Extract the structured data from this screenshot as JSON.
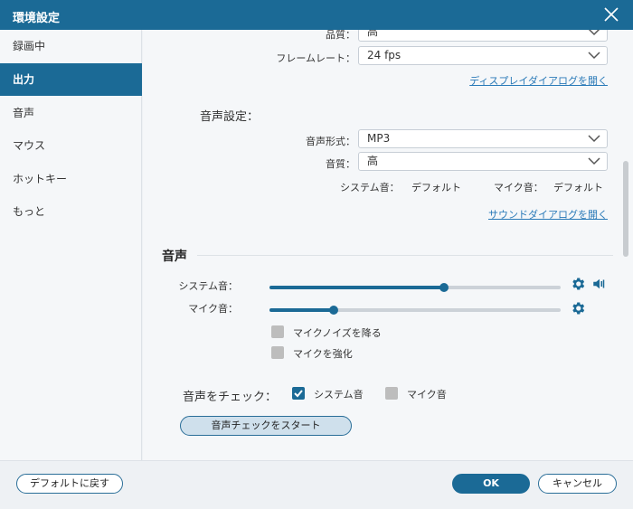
{
  "window": {
    "title": "環境設定"
  },
  "sidebar": {
    "items": [
      {
        "label": "録画中"
      },
      {
        "label": "出力",
        "active": true
      },
      {
        "label": "音声"
      },
      {
        "label": "マウス"
      },
      {
        "label": "ホットキー"
      },
      {
        "label": "もっと"
      }
    ]
  },
  "output": {
    "quality_label": "品質：",
    "quality_value": "高",
    "framerate_label": "フレームレート：",
    "framerate_value": "24 fps",
    "display_dialog_link": "ディスプレイダイアログを開く",
    "audio_settings_heading": "音声設定：",
    "audio_format_label": "音声形式：",
    "audio_format_value": "MP3",
    "audio_quality_label": "音質：",
    "audio_quality_value": "高",
    "system_sound_label": "システム音：",
    "system_sound_value": "デフォルト",
    "mic_sound_label": "マイク音：",
    "mic_sound_value": "デフォルト",
    "sound_dialog_link": "サウンドダイアログを開く"
  },
  "audio": {
    "heading": "音声",
    "system_sound_label": "システム音：",
    "system_volume": 0.6,
    "mic_label": "マイク音：",
    "mic_volume": 0.22,
    "noise_reduction_label": "マイクノイズを降る",
    "noise_reduction_checked": false,
    "enhance_label": "マイクを強化",
    "enhance_checked": false,
    "check_title": "音声をチェック：",
    "check_system_label": "システム音",
    "check_system_checked": true,
    "check_mic_label": "マイク音",
    "check_mic_checked": false,
    "start_check_label": "音声チェックをスタート"
  },
  "footer": {
    "reset_label": "デフォルトに戻す",
    "ok_label": "OK",
    "cancel_label": "キャンセル"
  },
  "colors": {
    "accent": "#1b6a96",
    "link": "#2a7ab8",
    "checkbox_off": "#bdbdbd"
  },
  "icons": {
    "close": "close-icon",
    "chevron": "chevron-down-icon",
    "gear": "gear-icon",
    "speaker": "speaker-icon",
    "check": "checkmark-icon"
  }
}
